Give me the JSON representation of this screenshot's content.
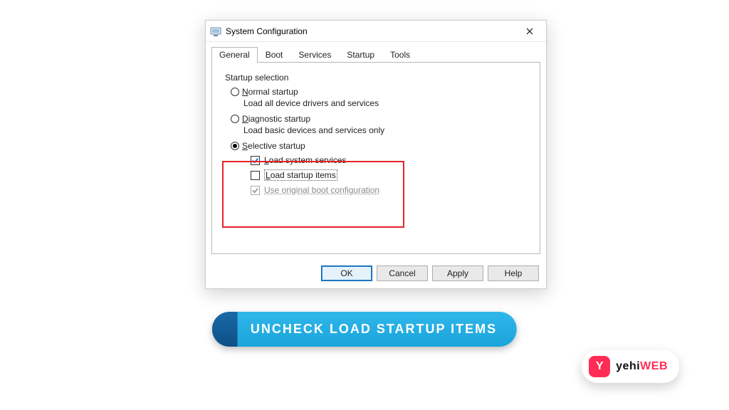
{
  "window": {
    "title": "System Configuration"
  },
  "tabs": {
    "general": "General",
    "boot": "Boot",
    "services": "Services",
    "startup": "Startup",
    "tools": "Tools"
  },
  "general": {
    "group_title": "Startup selection",
    "normal": {
      "label_pre": "N",
      "label_rest": "ormal startup",
      "desc": "Load all device drivers and services"
    },
    "diagnostic": {
      "label_pre": "D",
      "label_rest": "iagnostic startup",
      "desc": "Load basic devices and services only"
    },
    "selective": {
      "label_pre": "S",
      "label_rest": "elective startup"
    },
    "load_services": {
      "label_pre": "L",
      "label_rest": "oad system services"
    },
    "load_startup": {
      "label_pre": "L",
      "label_rest": "oad startup items"
    },
    "use_original": {
      "label_pre": "U",
      "label_rest": "se original boot configuration"
    }
  },
  "buttons": {
    "ok": "OK",
    "cancel": "Cancel",
    "apply": "Apply",
    "help": "Help"
  },
  "cta": {
    "strong": "UNCHECK",
    "rest": " LOAD STARTUP ITEMS"
  },
  "logo": {
    "mark": "Y",
    "text_a": "yehi",
    "text_b": "WEB"
  }
}
